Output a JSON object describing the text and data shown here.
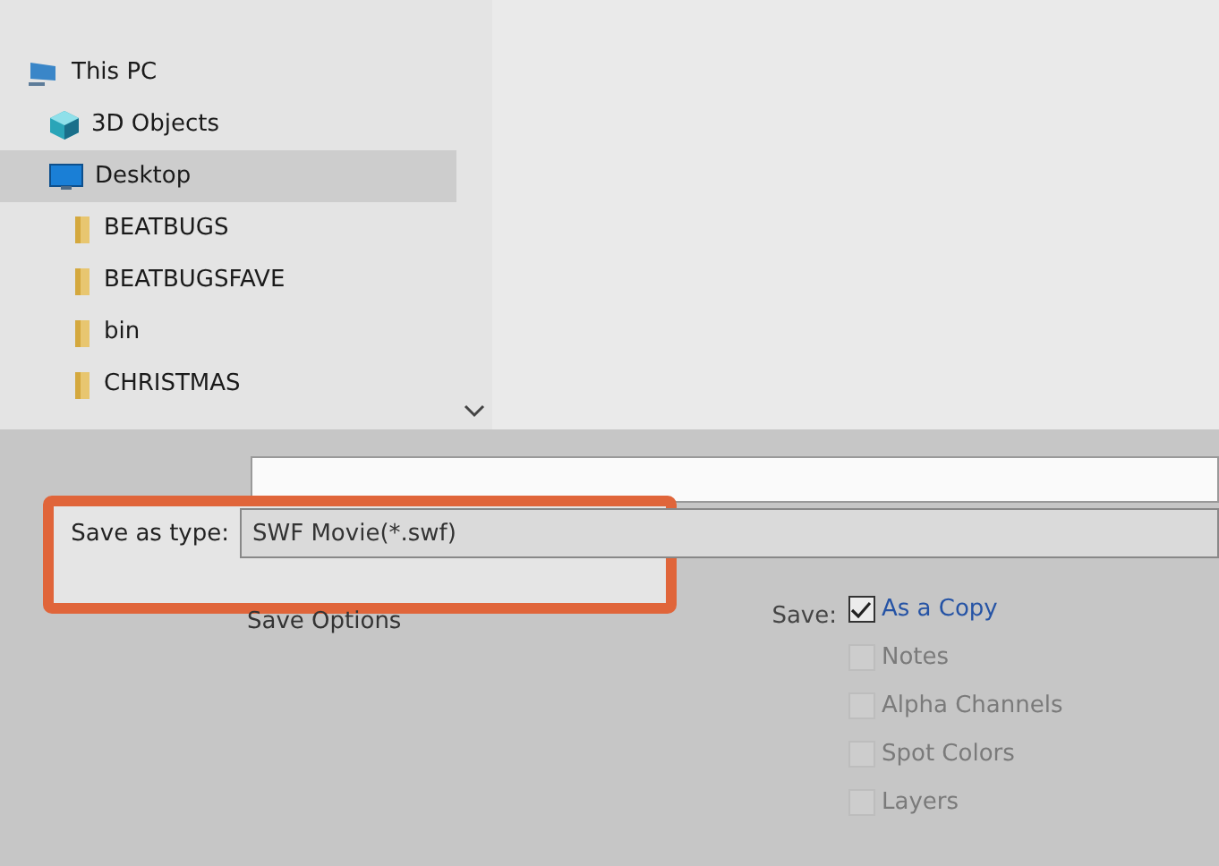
{
  "sidebar": {
    "items": [
      {
        "label": "This PC",
        "kind": "pc",
        "selected": false,
        "children": [
          {
            "label": "3D Objects",
            "kind": "cube",
            "selected": false
          },
          {
            "label": "Desktop",
            "kind": "desktop",
            "selected": true,
            "children": [
              {
                "label": "BEATBUGS",
                "kind": "folder",
                "selected": false
              },
              {
                "label": "BEATBUGSFAVE",
                "kind": "folder",
                "selected": false
              },
              {
                "label": "bin",
                "kind": "folder",
                "selected": false
              },
              {
                "label": "CHRISTMAS",
                "kind": "folder",
                "selected": false
              }
            ]
          }
        ]
      }
    ]
  },
  "save_as_type": {
    "label": "Save as type:",
    "value": "SWF Movie(*.swf)"
  },
  "save_options": {
    "label": "Save Options"
  },
  "save": {
    "label": "Save:",
    "options": [
      {
        "label": "As a Copy",
        "checked": true,
        "disabled": false
      },
      {
        "label": "Notes",
        "checked": false,
        "disabled": true
      },
      {
        "label": "Alpha Channels",
        "checked": false,
        "disabled": true
      },
      {
        "label": "Spot Colors",
        "checked": false,
        "disabled": true
      },
      {
        "label": "Layers",
        "checked": false,
        "disabled": true
      }
    ]
  }
}
